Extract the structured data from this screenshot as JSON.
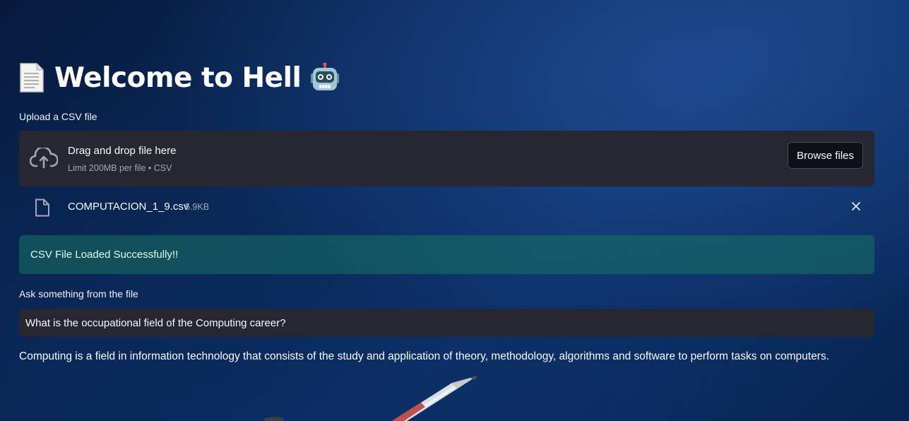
{
  "header": {
    "title": "Welcome to Hell",
    "leading_icon": "document-icon",
    "trailing_icon": "robot-icon"
  },
  "uploader": {
    "label": "Upload a CSV file",
    "drag_text": "Drag and drop file here",
    "limit_text": "Limit 200MB per file • CSV",
    "browse_label": "Browse files",
    "icon": "cloud-upload-icon"
  },
  "uploaded_file": {
    "name": "COMPUTACION_1_9.csv",
    "size": "5.9KB",
    "icon": "file-icon",
    "remove_icon": "close-icon"
  },
  "status": {
    "message": "CSV File Loaded Successfully!!",
    "color": "#177260"
  },
  "query": {
    "label": "Ask something from the file",
    "value": "What is the occupational field of the Computing career?"
  },
  "answer": {
    "text": "Computing is a field in information technology that consists of the study and application of theory, methodology, algorithms and software to perform tasks on computers."
  },
  "colors": {
    "background": "#0b2c5e",
    "widget_bg": "#262730",
    "text": "#fafafa",
    "muted_text": "#a3a8b8"
  }
}
